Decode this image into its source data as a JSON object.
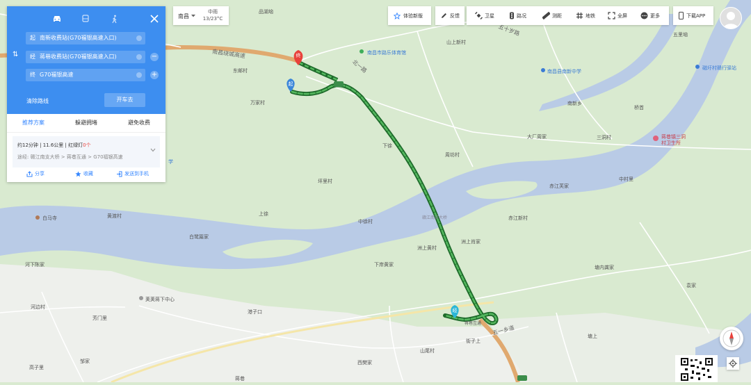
{
  "colors": {
    "accent": "#3d8ef0",
    "link": "#3385ff",
    "route": "#2f8a3c",
    "river": "#b9cbe6",
    "land": "#d9ead0",
    "highway": "#e0a96f",
    "start_marker": "#3b86d9",
    "end_marker": "#e8413b",
    "via_marker": "#2bb6d6"
  },
  "panel": {
    "modes": [
      {
        "icon": "car-icon",
        "active": true
      },
      {
        "icon": "bus-icon",
        "active": false
      },
      {
        "icon": "walk-icon",
        "active": false
      }
    ],
    "close_icon": "close-icon",
    "start": {
      "tag": "起",
      "value": "南新收费站(G70福银高速入口)"
    },
    "via": {
      "tag": "经",
      "value": "蒋巷收费站(G70福银高速入口)"
    },
    "end": {
      "tag": "终",
      "value": "G70福银高速"
    },
    "swap_symbol": "⇅",
    "remove_symbol": "−",
    "add_symbol": "+",
    "clear_label": "清除路线",
    "go_label": "开车去",
    "tabs": [
      "推荐方案",
      "躲避拥堵",
      "避免收费"
    ],
    "result": {
      "summary": "约12分钟  |  11.6公里  |  红绿灯",
      "lights": "0个",
      "via": "途经:  赣江南支大桥 > 蒋巷互通 > G70福银高速"
    },
    "actions": [
      {
        "icon": "share-icon",
        "label": "分享"
      },
      {
        "icon": "star-icon",
        "label": "收藏"
      },
      {
        "icon": "send-to-phone-icon",
        "label": "发送到手机"
      }
    ]
  },
  "city_bar": {
    "city": "南昌",
    "weather": "中雨",
    "temp": "13/23°C"
  },
  "toolbar": {
    "new_version": "体验新版",
    "feedback": "反馈",
    "satellite": "卫星",
    "traffic": "路况",
    "measure": "测距",
    "subway": "地铁",
    "fullscreen": "全屏",
    "more": "更多",
    "download": "下载APP"
  },
  "markers": {
    "start": "起",
    "end": "终",
    "via": "经"
  },
  "map_labels": [
    {
      "text": "品湖垴",
      "cls": ""
    },
    {
      "text": "南昌绕城高速",
      "cls": "road"
    },
    {
      "text": "东邮村",
      "cls": ""
    },
    {
      "text": "南昌市路乐体育馆",
      "cls": "blue"
    },
    {
      "text": "南昌县南新中学",
      "cls": "blue"
    },
    {
      "text": "山上新村",
      "cls": ""
    },
    {
      "text": "五里垴",
      "cls": ""
    },
    {
      "text": "磁圩村赣行驿站",
      "cls": "blue"
    },
    {
      "text": "五十岁路",
      "cls": "road"
    },
    {
      "text": "南新乡",
      "cls": ""
    },
    {
      "text": "桥首",
      "cls": ""
    },
    {
      "text": "大厂周家",
      "cls": ""
    },
    {
      "text": "三洞村",
      "cls": ""
    },
    {
      "text": "蒋巷镇三洞村卫生所",
      "cls": "red"
    },
    {
      "text": "万家村",
      "cls": ""
    },
    {
      "text": "下徐",
      "cls": ""
    },
    {
      "text": "周坊村",
      "cls": ""
    },
    {
      "text": "坪里村",
      "cls": ""
    },
    {
      "text": "中村里",
      "cls": ""
    },
    {
      "text": "赤江芙家",
      "cls": ""
    },
    {
      "text": "上徐",
      "cls": ""
    },
    {
      "text": "中徐村",
      "cls": ""
    },
    {
      "text": "赤江新村",
      "cls": ""
    },
    {
      "text": "黄渡村",
      "cls": ""
    },
    {
      "text": "白马寺",
      "cls": ""
    },
    {
      "text": "白鹭篇家",
      "cls": ""
    },
    {
      "text": "洲上黄村",
      "cls": ""
    },
    {
      "text": "洲上肖家",
      "cls": ""
    },
    {
      "text": "下岸黄家",
      "cls": ""
    },
    {
      "text": "塘内龚家",
      "cls": ""
    },
    {
      "text": "河下陈家",
      "cls": ""
    },
    {
      "text": "袁家",
      "cls": ""
    },
    {
      "text": "河边村",
      "cls": ""
    },
    {
      "text": "荚荚蒋下中心",
      "cls": ""
    },
    {
      "text": "港子口",
      "cls": ""
    },
    {
      "text": "芳门里",
      "cls": ""
    },
    {
      "text": "街子上",
      "cls": ""
    },
    {
      "text": "塘上",
      "cls": ""
    },
    {
      "text": "山尾村",
      "cls": ""
    },
    {
      "text": "邹家",
      "cls": ""
    },
    {
      "text": "西樊家",
      "cls": ""
    },
    {
      "text": "蒋巷",
      "cls": ""
    },
    {
      "text": "蒋巷互通",
      "cls": ""
    },
    {
      "text": "赣江南支大桥",
      "cls": ""
    },
    {
      "text": "五一乡道",
      "cls": "road"
    },
    {
      "text": "北一路",
      "cls": "road"
    },
    {
      "text": "高子里",
      "cls": ""
    },
    {
      "text": "学",
      "cls": "blue"
    }
  ]
}
